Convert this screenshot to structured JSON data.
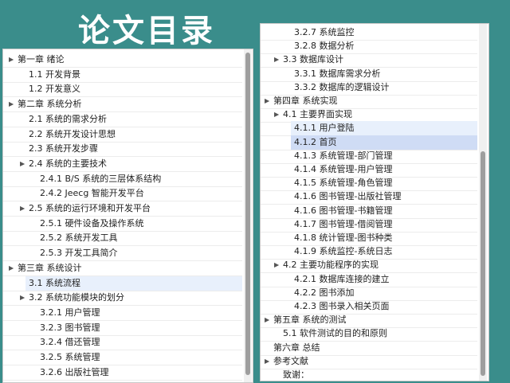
{
  "title": "论文目录",
  "left_panel": {
    "items": [
      {
        "text": "第一章  绪论",
        "level": 0,
        "arrow": "▲"
      },
      {
        "text": "1.1  开发背景",
        "level": 1,
        "arrow": ""
      },
      {
        "text": "1.2  开发意义",
        "level": 1,
        "arrow": ""
      },
      {
        "text": "第二章  系统分析",
        "level": 0,
        "arrow": "▲"
      },
      {
        "text": "2.1  系统的需求分析",
        "level": 1,
        "arrow": ""
      },
      {
        "text": "2.2  系统开发设计思想",
        "level": 1,
        "arrow": ""
      },
      {
        "text": "2.3  系统开发步骤",
        "level": 1,
        "arrow": ""
      },
      {
        "text": "2.4  系统的主要技术",
        "level": 1,
        "arrow": "▲"
      },
      {
        "text": "2.4.1 B/S 系统的三层体系结构",
        "level": 2,
        "arrow": ""
      },
      {
        "text": "2.4.2 Jeecg 智能开发平台",
        "level": 2,
        "arrow": ""
      },
      {
        "text": "2.5  系统的运行环境和开发平台",
        "level": 1,
        "arrow": "▲"
      },
      {
        "text": "2.5.1  硬件设备及操作系统",
        "level": 2,
        "arrow": ""
      },
      {
        "text": "2.5.2  系统开发工具",
        "level": 2,
        "arrow": ""
      },
      {
        "text": "2.5.3  开发工具简介",
        "level": 2,
        "arrow": ""
      },
      {
        "text": "第三章  系统设计",
        "level": 0,
        "arrow": "▲"
      },
      {
        "text": "3.1 系统流程",
        "level": 1,
        "arrow": "",
        "selected": true
      },
      {
        "text": "3.2  系统功能模块的划分",
        "level": 1,
        "arrow": "▲"
      },
      {
        "text": "3.2.1 用户管理",
        "level": 2,
        "arrow": ""
      },
      {
        "text": "3.2.3  图书管理",
        "level": 2,
        "arrow": ""
      },
      {
        "text": "3.2.4 借还管理",
        "level": 2,
        "arrow": ""
      },
      {
        "text": "3.2.5  系统管理",
        "level": 2,
        "arrow": ""
      },
      {
        "text": "3.2.6  出版社管理",
        "level": 2,
        "arrow": ""
      }
    ]
  },
  "right_panel": {
    "items": [
      {
        "text": "3.2.7  系统监控",
        "level": 2,
        "arrow": ""
      },
      {
        "text": "3.2.8  数据分析",
        "level": 2,
        "arrow": ""
      },
      {
        "text": "3.3 数据库设计",
        "level": 1,
        "arrow": "▲"
      },
      {
        "text": "3.3.1 数据库需求分析",
        "level": 2,
        "arrow": ""
      },
      {
        "text": "3.3.2 数据库的逻辑设计",
        "level": 2,
        "arrow": ""
      },
      {
        "text": "第四章  系统实现",
        "level": 0,
        "arrow": "▲"
      },
      {
        "text": "4.1 主要界面实现",
        "level": 1,
        "arrow": "▲"
      },
      {
        "text": "4.1.1 用户登陆",
        "level": 2,
        "arrow": "",
        "selected": true
      },
      {
        "text": "4.1.2  首页",
        "level": 2,
        "arrow": "",
        "selected2": true
      },
      {
        "text": "4.1.3  系统管理-部门管理",
        "level": 2,
        "arrow": ""
      },
      {
        "text": "4.1.4 系统管理-用户管理",
        "level": 2,
        "arrow": ""
      },
      {
        "text": "4.1.5 系统管理-角色管理",
        "level": 2,
        "arrow": ""
      },
      {
        "text": "4.1.6 图书管理-出版社管理",
        "level": 2,
        "arrow": ""
      },
      {
        "text": "4.1.6 图书管理-书籍管理",
        "level": 2,
        "arrow": ""
      },
      {
        "text": "4.1.7 图书管理-借阅管理",
        "level": 2,
        "arrow": ""
      },
      {
        "text": "4.1.8 统计管理-图书种类",
        "level": 2,
        "arrow": ""
      },
      {
        "text": "4.1.9 系统监控-系统日志",
        "level": 2,
        "arrow": ""
      },
      {
        "text": "4.2 主要功能程序的实现",
        "level": 1,
        "arrow": "▲"
      },
      {
        "text": "4.2.1  数据库连接的建立",
        "level": 2,
        "arrow": ""
      },
      {
        "text": "4.2.2 图书添加",
        "level": 2,
        "arrow": ""
      },
      {
        "text": "4.2.3 图书录入相关页面",
        "level": 2,
        "arrow": ""
      },
      {
        "text": "第五章  系统的测试",
        "level": 0,
        "arrow": "▲"
      },
      {
        "text": "5.1   软件测试的目的和原则",
        "level": 1,
        "arrow": ""
      },
      {
        "text": "第六章    总结",
        "level": 0,
        "arrow": ""
      },
      {
        "text": "参考文献",
        "level": 0,
        "arrow": "▲"
      },
      {
        "text": "致谢：",
        "level": 1,
        "arrow": ""
      }
    ]
  },
  "colors": {
    "background": "#3a8d8b",
    "selected": "#e8f0fc",
    "selected_strong": "#cfdcf5"
  }
}
